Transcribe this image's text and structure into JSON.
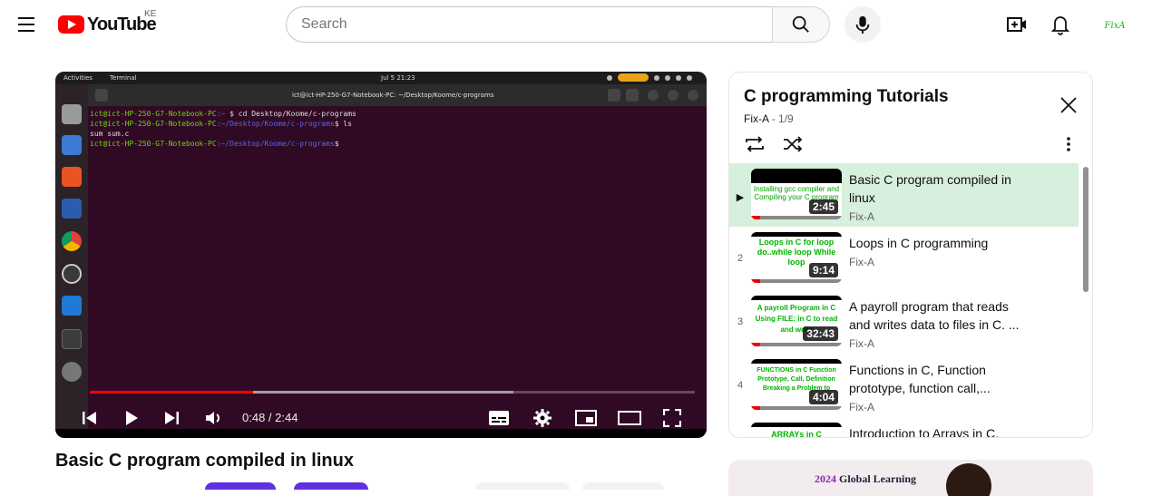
{
  "header": {
    "logo_text": "YouTube",
    "country_code": "KE",
    "search_placeholder": "Search",
    "avatar_text": "FixA"
  },
  "player": {
    "os": {
      "activities": "Activities",
      "app": "Terminal",
      "clock": "Jul 5  21:23"
    },
    "terminal": {
      "title": "ict@ict-HP-250-G7-Notebook-PC: ~/Desktop/Koome/c-programs",
      "lines": [
        {
          "user": "ict@ict-HP-250-G7-Notebook-PC",
          "path": ":~",
          "cmd": "$ cd Desktop/Koome/c-programs"
        },
        {
          "user": "ict@ict-HP-250-G7-Notebook-PC",
          "path": ":~/Desktop/Koome/c-programs",
          "cmd": "$ ls"
        },
        {
          "user": "",
          "path": "",
          "cmd": "sum  sum.c"
        },
        {
          "user": "ict@ict-HP-250-G7-Notebook-PC",
          "path": ":~/Desktop/Koome/c-programs",
          "cmd": "$"
        }
      ]
    },
    "progress": {
      "played_fraction": 0.27,
      "buffered_fraction": 0.7
    },
    "time_display": "0:48 / 2:44"
  },
  "video": {
    "title": "Basic C program compiled in linux"
  },
  "playlist": {
    "title": "C programming Tutorials",
    "channel": "Fix-A",
    "position": "1/9",
    "items": [
      {
        "index": "▶",
        "title": "Basic C program compiled in linux",
        "channel": "Fix-A",
        "duration": "2:45",
        "thumb_text": "Installing gcc compiler and Compiling your C program",
        "active": true
      },
      {
        "index": "2",
        "title": "Loops in C programming",
        "channel": "Fix-A",
        "duration": "9:14",
        "thumb_text": "Loops in C for loop do..while loop While loop",
        "active": false
      },
      {
        "index": "3",
        "title": "A payroll program that reads and writes data to files in C. ...",
        "channel": "Fix-A",
        "duration": "32:43",
        "thumb_text": "A payroll Program in C Using FILE: in C to read and write",
        "active": false
      },
      {
        "index": "4",
        "title": "Functions in C, Function prototype, function call,...",
        "channel": "Fix-A",
        "duration": "4:04",
        "thumb_text": "FUNCTIONS in C Function Prototype, Call, Definition Breaking a Problem to",
        "active": false
      },
      {
        "index": "5",
        "title": "Introduction to Arrays in C,",
        "channel": "",
        "duration": "",
        "thumb_text": "ARRAYs in C",
        "active": false
      }
    ]
  },
  "ad": {
    "year": "2024",
    "text": "Global Learning"
  },
  "colors": {
    "brand_red": "#ff0000",
    "active_row": "#d7efdd",
    "terminal_bg": "#300a24"
  }
}
